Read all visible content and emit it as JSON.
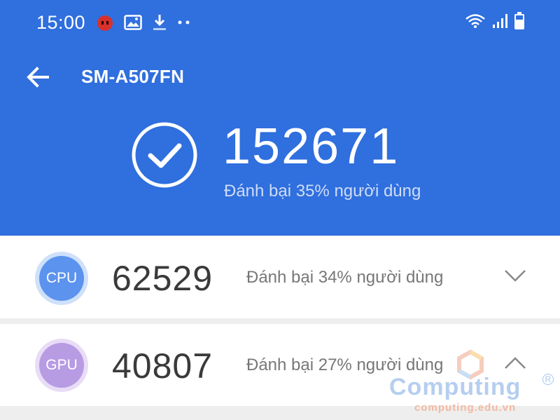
{
  "status_bar": {
    "time": "15:00",
    "left_icons": [
      "antutu-app-icon",
      "image-icon",
      "download-icon",
      "more-dots-icon"
    ],
    "right_icons": [
      "wifi-icon",
      "signal-icon",
      "battery-icon"
    ]
  },
  "toolbar": {
    "back_icon": "back-arrow-icon",
    "title": "SM-A507FN"
  },
  "total": {
    "score": "152671",
    "subtitle": "Đánh bại 35% người dùng"
  },
  "cards": [
    {
      "label": "CPU",
      "score": "62529",
      "subtitle": "Đánh bại 34% người dùng",
      "chevron": "chevron-down-icon",
      "color": "#5b93ee"
    },
    {
      "label": "GPU",
      "score": "40807",
      "subtitle": "Đánh bại 27% người dùng",
      "chevron": "chevron-up-icon",
      "color": "#b79be3"
    }
  ],
  "watermark": {
    "name": "Computing",
    "url": "computing.edu.vn"
  },
  "colors": {
    "header_blue": "#2f6fde",
    "card_bg": "#ffffff",
    "page_bg": "#eeeeee"
  }
}
